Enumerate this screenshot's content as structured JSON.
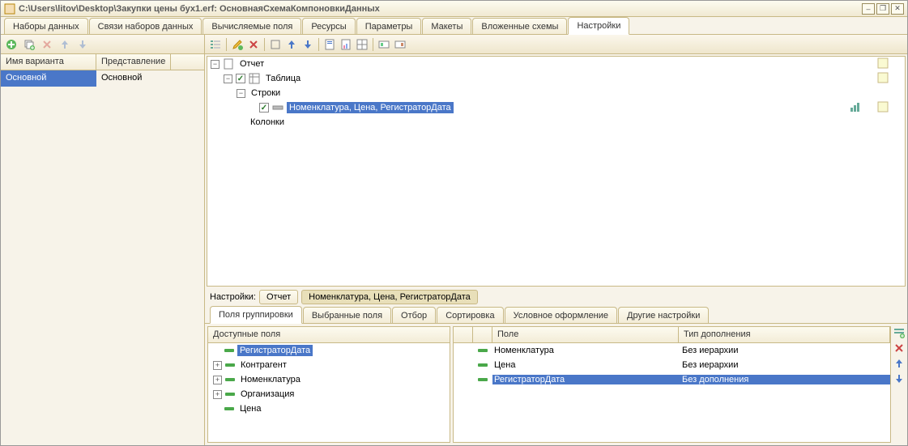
{
  "window": {
    "title": "C:\\Users\\litov\\Desktop\\Закупки цены бух1.erf: ОсновнаяСхемаКомпоновкиДанных"
  },
  "mainTabs": [
    {
      "label": "Наборы данных"
    },
    {
      "label": "Связи наборов данных"
    },
    {
      "label": "Вычисляемые поля"
    },
    {
      "label": "Ресурсы"
    },
    {
      "label": "Параметры"
    },
    {
      "label": "Макеты"
    },
    {
      "label": "Вложенные схемы"
    },
    {
      "label": "Настройки",
      "active": true
    }
  ],
  "variantHeader": {
    "col1": "Имя варианта",
    "col2": "Представление"
  },
  "variantRow": {
    "name": "Основной",
    "repr": "Основной"
  },
  "tree": {
    "root": "Отчет",
    "table": "Таблица",
    "rows": "Строки",
    "rowFields": "Номенклатура, Цена, РегистраторДата",
    "cols": "Колонки"
  },
  "breadcrumb": {
    "label": "Настройки:",
    "p1": "Отчет",
    "p2": "Номенклатура, Цена, РегистраторДата"
  },
  "subTabs": [
    {
      "label": "Поля группировки",
      "active": true
    },
    {
      "label": "Выбранные поля"
    },
    {
      "label": "Отбор"
    },
    {
      "label": "Сортировка"
    },
    {
      "label": "Условное оформление"
    },
    {
      "label": "Другие настройки"
    }
  ],
  "availHeader": "Доступные поля",
  "availFields": [
    {
      "label": "РегистраторДата",
      "sel": true,
      "exp": false
    },
    {
      "label": "Контрагент",
      "exp": true
    },
    {
      "label": "Номенклатура",
      "exp": true
    },
    {
      "label": "Организация",
      "exp": true
    },
    {
      "label": "Цена",
      "exp": false
    }
  ],
  "fieldsHeader": {
    "c3": "Поле",
    "c4": "Тип дополнения"
  },
  "fieldRows": [
    {
      "field": "Номенклатура",
      "type": "Без иерархии"
    },
    {
      "field": "Цена",
      "type": "Без иерархии"
    },
    {
      "field": "РегистраторДата",
      "type": "Без дополнения",
      "sel": true
    }
  ]
}
